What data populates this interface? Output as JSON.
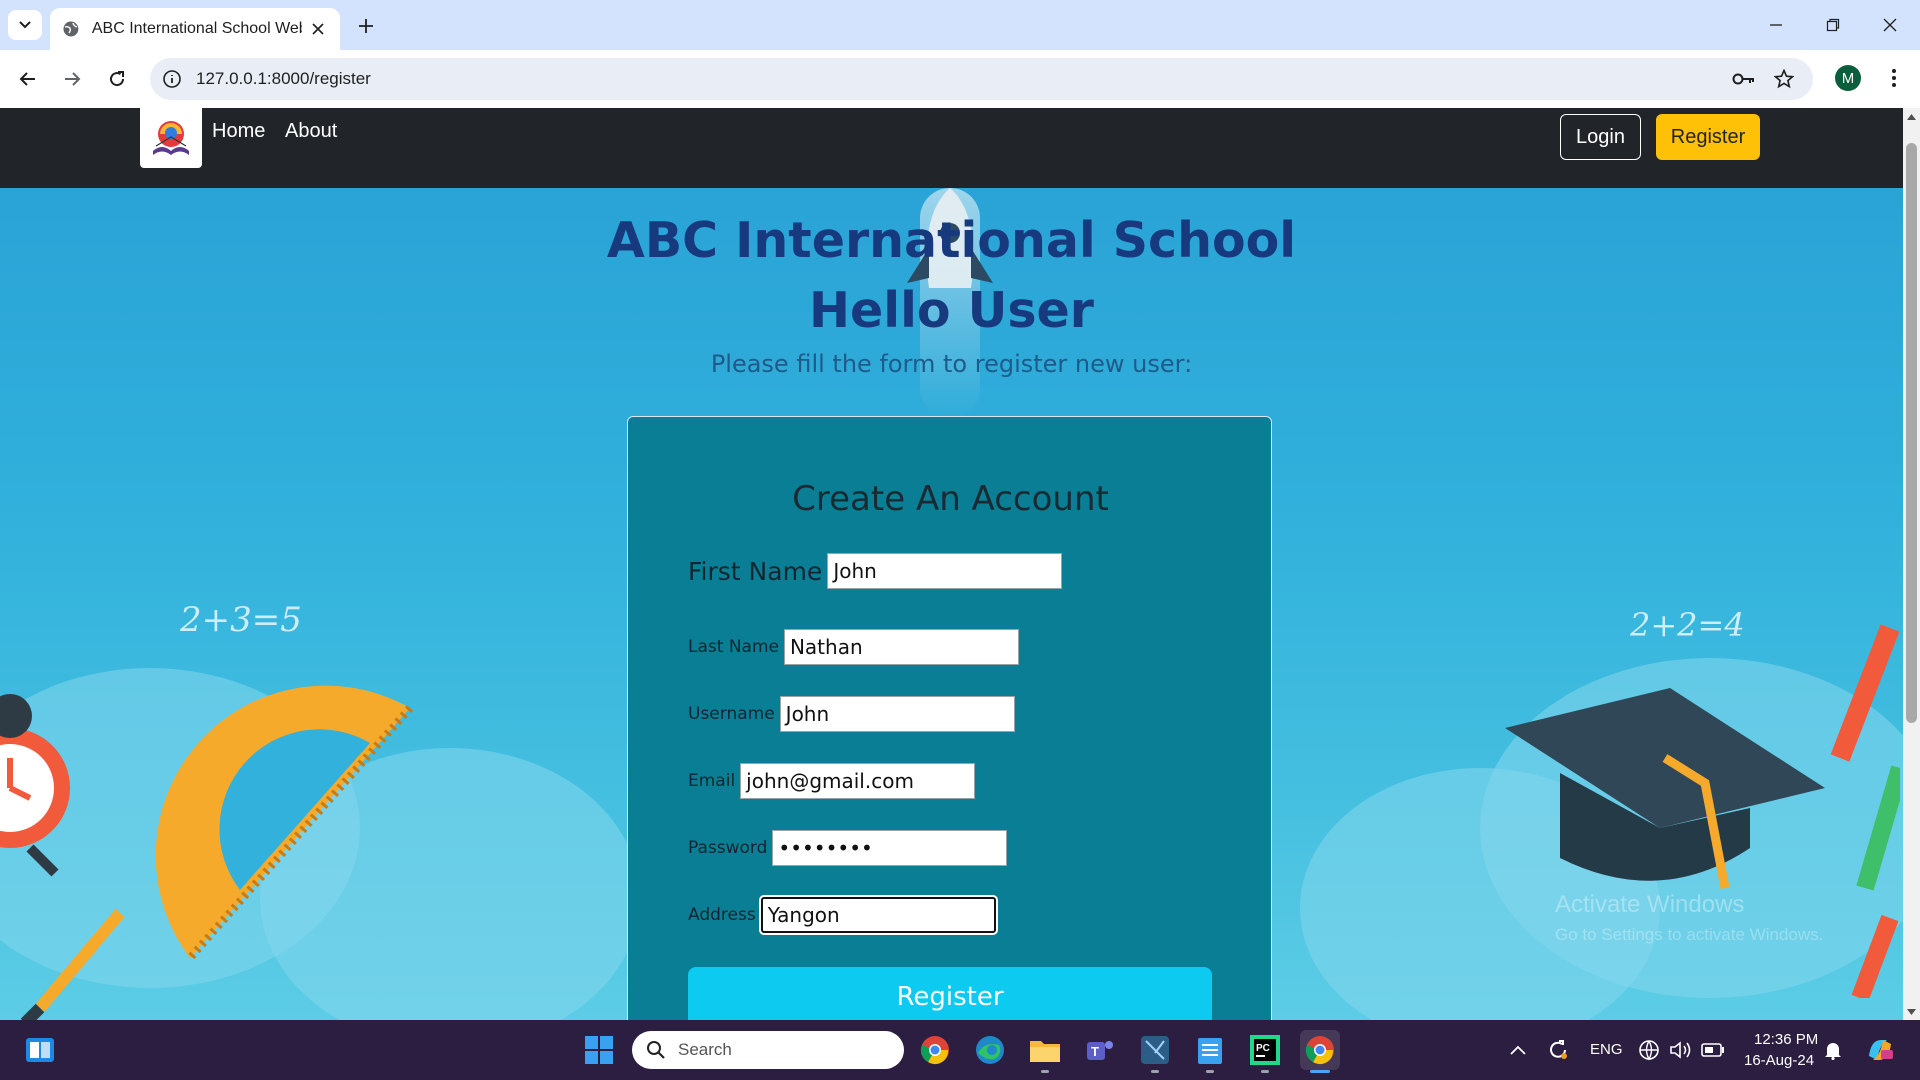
{
  "browser": {
    "tab_title": "ABC International School WebA",
    "url": "127.0.0.1:8000/register",
    "profile_initial": "M"
  },
  "navbar": {
    "links": [
      "Home",
      "About"
    ],
    "login_label": "Login",
    "register_label": "Register"
  },
  "hero": {
    "title": "ABC International School",
    "subtitle": "Hello User",
    "instruction": "Please fill the form to register new user:"
  },
  "form": {
    "title": "Create An Account",
    "fields": [
      {
        "label": "First Name",
        "value": "John"
      },
      {
        "label": "Last Name",
        "value": "Nathan"
      },
      {
        "label": "Username",
        "value": "John"
      },
      {
        "label": "Email",
        "value": "john@gmail.com"
      },
      {
        "label": "Password",
        "value": "••••••••"
      },
      {
        "label": "Address",
        "value": "Yangon"
      }
    ],
    "submit_label": "Register"
  },
  "decorations": {
    "board_text_left": "2+3=5",
    "board_text_right": "2+2=4",
    "watermark": "Activate Windows",
    "watermark_sub": "Go to Settings to activate Windows."
  },
  "taskbar": {
    "search_placeholder": "Search",
    "language": "ENG",
    "time": "12:36 PM",
    "date": "16-Aug-24"
  },
  "colors": {
    "navbar_bg": "#212529",
    "register_btn": "#ffc107",
    "form_bg": "#0a7e95",
    "submit_btn": "#0dcaf0",
    "title_color": "#17397e"
  }
}
